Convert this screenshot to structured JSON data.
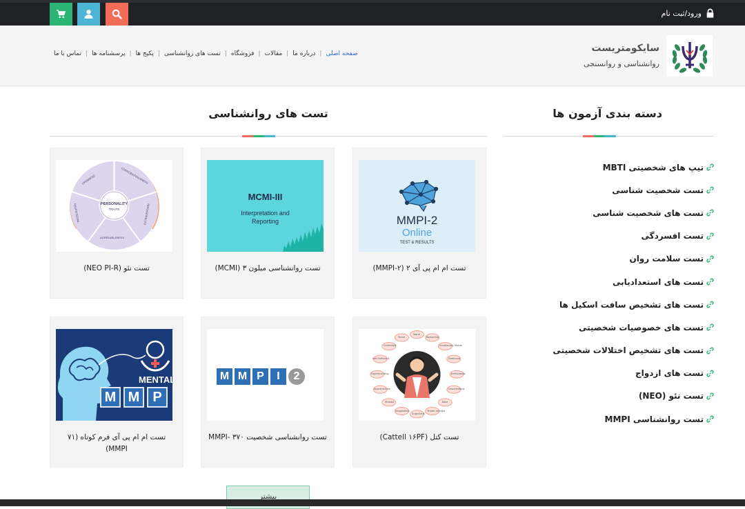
{
  "topbar": {
    "login_label": "ورود/ثبت نام"
  },
  "header": {
    "brand_title": "سایکومتریست",
    "brand_subtitle": "روانشناسی و روانسنجی",
    "nav": [
      {
        "label": "صفحه اصلی"
      },
      {
        "label": "درباره ما"
      },
      {
        "label": "مقالات"
      },
      {
        "label": "فروشگاه"
      },
      {
        "label": "تست های روانشناسی"
      },
      {
        "label": "پکیج ها"
      },
      {
        "label": "پرسشنامه ها"
      },
      {
        "label": "تماس با ما"
      }
    ]
  },
  "sidebar": {
    "title": "دسته بندی آزمون ها",
    "items": [
      {
        "label": "تیپ های شخصیتی MBTI"
      },
      {
        "label": "تست شخصیت شناسی"
      },
      {
        "label": "تست های شخصیت شناسی"
      },
      {
        "label": "تست افسردگی"
      },
      {
        "label": "تست سلامت روان"
      },
      {
        "label": "تست های استعدادیابی"
      },
      {
        "label": "تست های تشخیص سافت اسکیل ها"
      },
      {
        "label": "تست های خصوصیات شخصیتی"
      },
      {
        "label": "تست های تشخیص اختلالات شخصیتی"
      },
      {
        "label": "تست های ازدواج"
      },
      {
        "label": "تست نئو (NEO)"
      },
      {
        "label": "تست روانشناسی MMPI"
      }
    ]
  },
  "main": {
    "title": "تست های روانشناسی",
    "more_label": "بیشتر",
    "cards": [
      {
        "title": "تست ام ام پی آی ۲ (MMPI-۲)",
        "img_line1": "MMPI-2",
        "img_line2": "Online",
        "img_line3": "TEST & RESULTS"
      },
      {
        "title": "تست روانشناسی میلون ۳ (MCMI)",
        "img_line1": "MCMI-III",
        "img_line2": "Interpretation and",
        "img_line3": "Reporting"
      },
      {
        "title": "تست نئو (NEO PI-R)",
        "img_line1": "PERSONALITY",
        "img_line2": "TRAITS",
        "img_words": [
          "OPENNESS",
          "CONSCIENTIOUSNESS",
          "EXTRAVERSION",
          "AGREEABLENESS",
          "NEUROTICISM"
        ]
      },
      {
        "title": "تست کتل (Cattell ۱۶PF)",
        "img_words": [
          "Warm",
          "Reasoning",
          "Emotionally Stable",
          "Dominant",
          "Enthusiastic",
          "Conscientious",
          "Bold",
          "Tender-minded",
          "Suspicious",
          "Imaginative",
          "Shrewd",
          "Apprehensive",
          "Experimenting",
          "Self-Sufficient",
          "Controlled",
          "Tense"
        ]
      },
      {
        "title": "تست روانشناسی شخصیت MMPI- ۳۷۰",
        "img_letters": [
          "M",
          "M",
          "P",
          "I",
          "2"
        ]
      },
      {
        "title": "تست ام ام پی آی فرم کوتاه (۷۱ MMPI)",
        "img_label": "MENTAL",
        "img_letters": [
          "M",
          "M",
          "P"
        ]
      }
    ]
  },
  "colors": {
    "cart": "#2bb673",
    "user": "#4cb4d4",
    "search": "#f26c5a",
    "nav_active": "#2a6bd6",
    "link_icon": "#2bb673"
  }
}
